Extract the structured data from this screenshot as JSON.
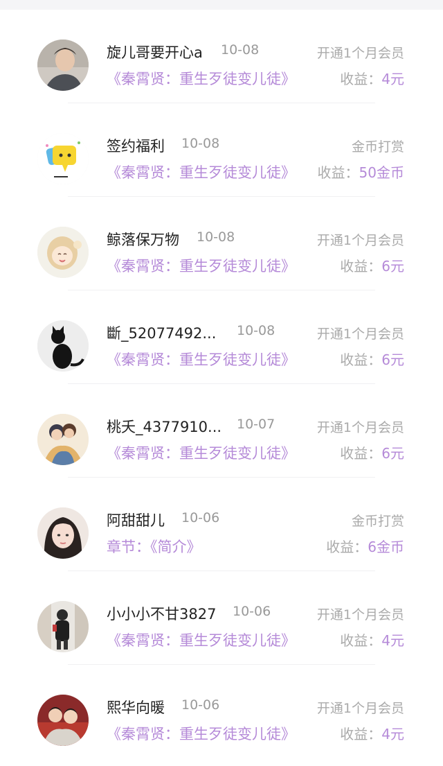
{
  "colors": {
    "accent": "#b58ad8",
    "muted": "#aaaaaa",
    "text": "#222222"
  },
  "earnings_label": "收益：",
  "items": [
    {
      "name": "旋儿哥要开心a",
      "date": "10-08",
      "type": "开通1个月会员",
      "work": "《秦霄贤：重生歹徒变儿徒》",
      "amount": "4元",
      "avatar_icon": "man-portrait-avatar"
    },
    {
      "name": "签约福利",
      "date": "10-08",
      "type": "金币打赏",
      "work": "《秦霄贤：重生歹徒变儿徒》",
      "amount": "50金币",
      "avatar_icon": "chat-bubble-avatar"
    },
    {
      "name": "鲸落保万物",
      "date": "10-08",
      "type": "开通1个月会员",
      "work": "《秦霄贤：重生歹徒变儿徒》",
      "amount": "6元",
      "avatar_icon": "anime-girl-avatar"
    },
    {
      "name": "斷_52077492...",
      "date": "10-08",
      "type": "开通1个月会员",
      "work": "《秦霄贤：重生歹徒变儿徒》",
      "amount": "6元",
      "avatar_icon": "black-cat-avatar"
    },
    {
      "name": "桃夭_4377910...",
      "date": "10-07",
      "type": "开通1个月会员",
      "work": "《秦霄贤：重生歹徒变儿徒》",
      "amount": "6元",
      "avatar_icon": "anime-couple-avatar"
    },
    {
      "name": "阿甜甜儿",
      "date": "10-06",
      "type": "金币打赏",
      "work": "章节：《简介》",
      "amount": "6金币",
      "avatar_icon": "girl-portrait-avatar"
    },
    {
      "name": "小小小不甘3827",
      "date": "10-06",
      "type": "开通1个月会员",
      "work": "《秦霄贤：重生歹徒变儿徒》",
      "amount": "4元",
      "avatar_icon": "person-street-avatar"
    },
    {
      "name": "熙华向暖",
      "date": "10-06",
      "type": "开通1个月会员",
      "work": "《秦霄贤：重生歹徒变儿徒》",
      "amount": "4元",
      "avatar_icon": "two-boys-avatar"
    }
  ]
}
